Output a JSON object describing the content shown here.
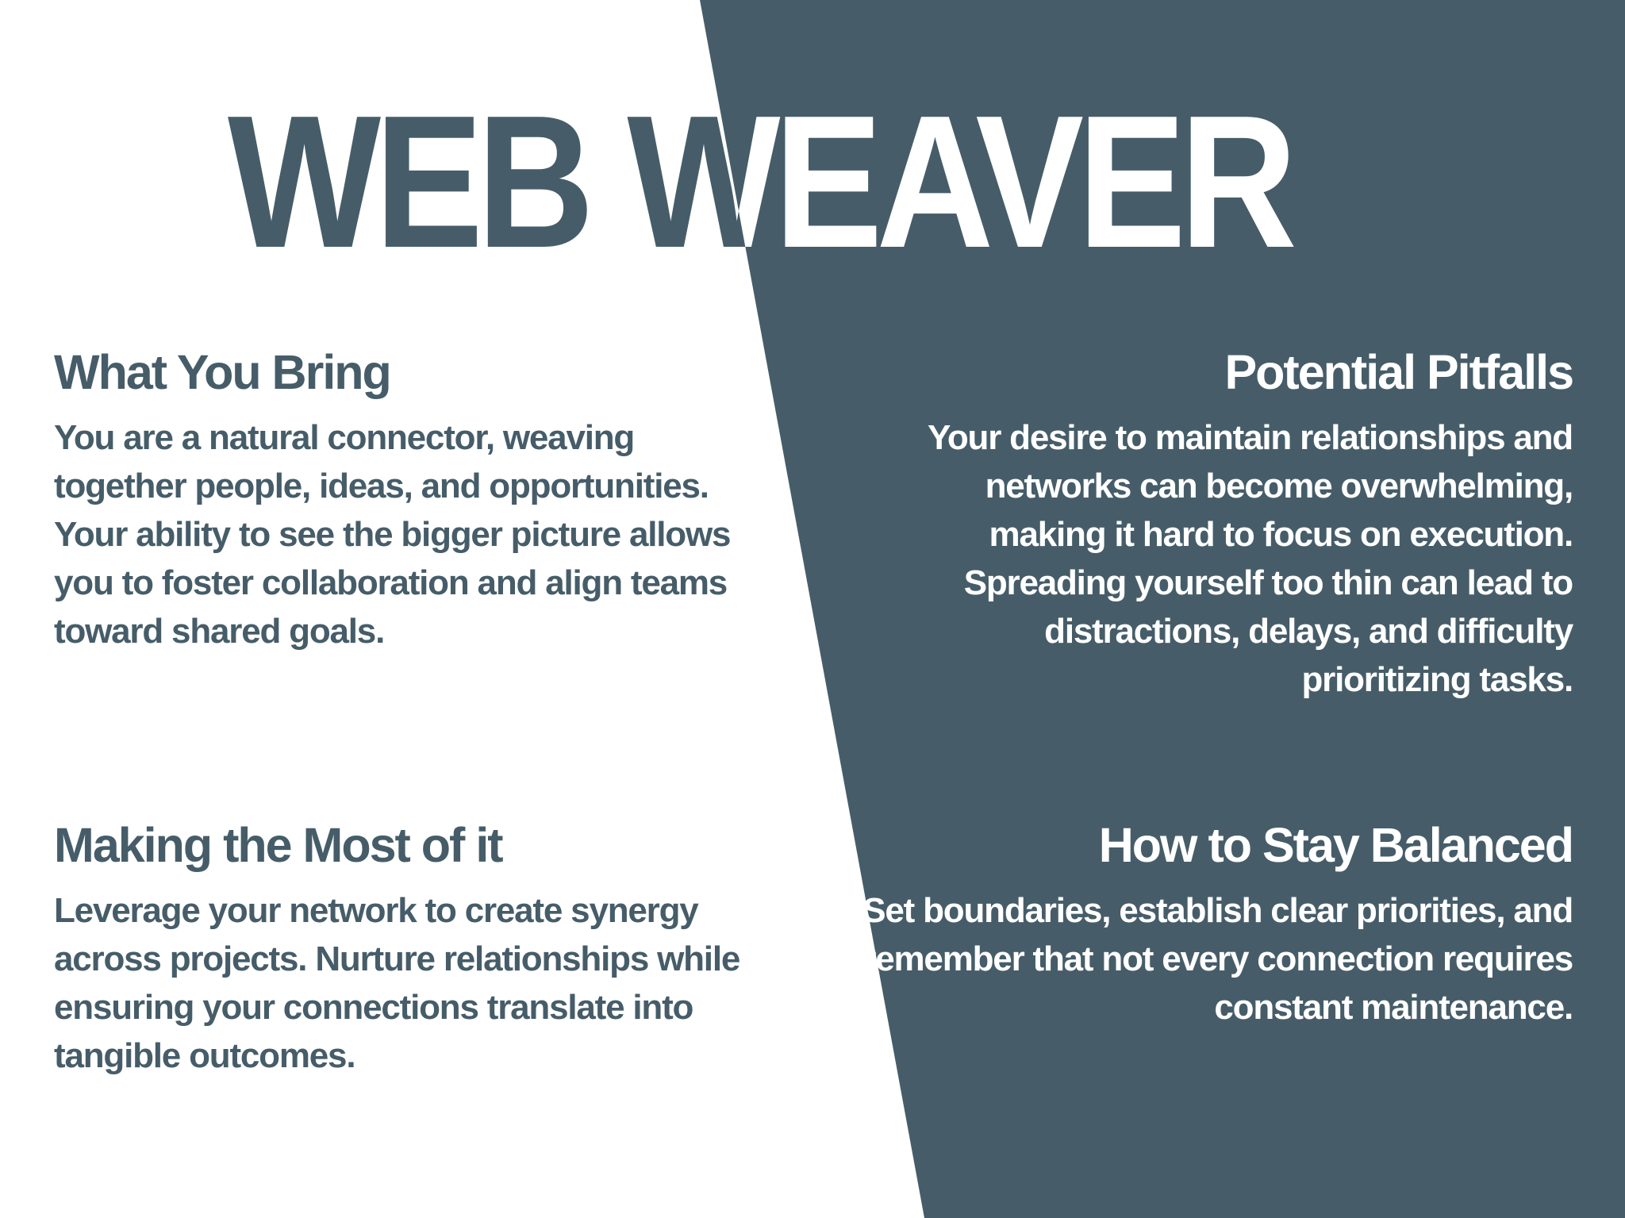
{
  "colors": {
    "panel": "#465d69",
    "background": "#ffffff",
    "dark_text": "#465d69",
    "light_text": "#ffffff"
  },
  "title": "WEB WEAVER",
  "sections": {
    "what_you_bring": {
      "heading": "What You Bring",
      "body": "You are a natural connector, weaving together people, ideas, and opportunities. Your ability to see the bigger picture allows you to foster collaboration and align teams toward shared goals."
    },
    "potential_pitfalls": {
      "heading": "Potential Pitfalls",
      "body": "Your desire to maintain relationships and networks can become overwhelming, making it hard to focus on execution. Spreading yourself too thin can lead to distractions, delays, and difficulty prioritizing tasks."
    },
    "making_the_most": {
      "heading": "Making the Most of it",
      "body": "Leverage your network to create synergy across projects. Nurture relationships while ensuring your connections translate into tangible outcomes."
    },
    "stay_balanced": {
      "heading": "How to Stay Balanced",
      "body": "Set boundaries, establish clear priorities, and remember that not every connection requires constant maintenance."
    }
  }
}
